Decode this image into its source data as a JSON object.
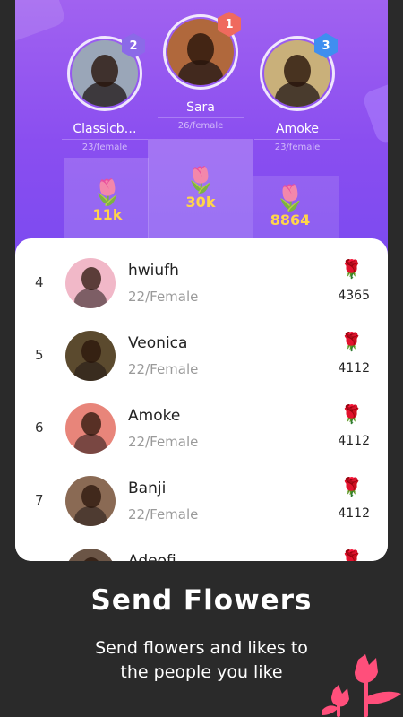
{
  "colors": {
    "accent": "#8a4ef0",
    "gold": "#ffd54a",
    "rank1": "#ef6a5e",
    "rank2": "#8b6ae8",
    "rank3": "#3f8ef0",
    "bottom_bg": "#2a2a2a",
    "tulip": "#ff4f7b"
  },
  "icons": {
    "flower": "🌷",
    "row_flower": "🌹"
  },
  "top3": [
    {
      "rank": "2",
      "name": "Classicb…",
      "sub": "23/female",
      "score": "11k",
      "avatar_color": "#9aa6b8"
    },
    {
      "rank": "1",
      "name": "Sara",
      "sub": "26/female",
      "score": "30k",
      "avatar_color": "#b0683c"
    },
    {
      "rank": "3",
      "name": "Amoke",
      "sub": "23/female",
      "score": "8864",
      "avatar_color": "#c9b07a"
    }
  ],
  "list": [
    {
      "rank": "4",
      "name": "hwiufh",
      "meta": "22/Female",
      "count": "4365",
      "avatar_color": "#f1b8c8"
    },
    {
      "rank": "5",
      "name": "Veonica",
      "meta": "22/Female",
      "count": "4112",
      "avatar_color": "#5b4a2e"
    },
    {
      "rank": "6",
      "name": "Amoke",
      "meta": "22/Female",
      "count": "4112",
      "avatar_color": "#e8857a"
    },
    {
      "rank": "7",
      "name": "Banji",
      "meta": "22/Female",
      "count": "4112",
      "avatar_color": "#8a6a54"
    },
    {
      "rank": "",
      "name": "Adeofi…",
      "meta": "",
      "count": "",
      "avatar_color": "#6b5546"
    }
  ],
  "promo": {
    "title": "Send Flowers",
    "line1": "Send flowers and likes to",
    "line2": "the people you like"
  }
}
